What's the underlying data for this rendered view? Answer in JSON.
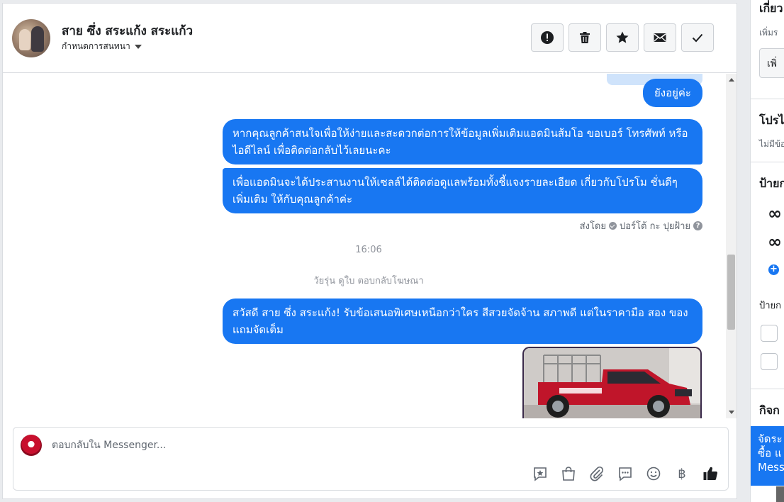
{
  "header": {
    "contact_name": "สาย ซึ่ง สระแก้ง สระแก้ว",
    "assign_label": "กำหนดการสนทนา"
  },
  "toolbar": {
    "icons": [
      "spam-icon",
      "trash-icon",
      "star-icon",
      "mail-icon",
      "checkmark-icon"
    ]
  },
  "messages": [
    {
      "id": "m0",
      "text": "ยังอยู่ค่ะ"
    },
    {
      "id": "m1",
      "text": "หากคุณลูกค้าสนใจเพื่อให้ง่ายและสะดวกต่อการให้ข้อมูลเพิ่มเติมแอดมินส้มโอ ขอเบอร์ โทรศัพท์ หรือ ไอดีไลน์ เพื่อติดต่อกลับไว้เลยนะคะ"
    },
    {
      "id": "m2",
      "text": "เพื่อแอดมินจะได้ประสานงานให้เซลล์ได้ติดต่อดูแลพร้อมทั้งชี้แจงรายละเอียด เกี่ยวกับโปรโม ชั่นดีๆเพิ่มเติม ให้กับคุณลูกค้าค่ะ"
    },
    {
      "id": "m3",
      "text": "สวัสดี สาย ซึ่ง สระแก้ง! รับข้อเสนอพิเศษเหนือกว่าใคร สีสวยจัดจ้าน สภาพดี แต่ในราคามือ สอง ของแถมจัดเต็ม"
    }
  ],
  "sent_by": {
    "prefix": "ส่งโดย",
    "name": "ปอร์โต้ กะ ปุยฝ้าย",
    "help": "?"
  },
  "timestamp": "16:06",
  "ad_reply_note": "วัยรุ่น ดูใบ ตอบกลับโฆษณา",
  "composer": {
    "placeholder": "ตอบกลับใน Messenger...",
    "icons": [
      "saved-reply-icon",
      "shop-bag-icon",
      "attachment-icon",
      "chat-bubble-icon",
      "emoji-icon",
      "baht-icon",
      "thumbs-up-icon"
    ],
    "baht_symbol": "฿"
  },
  "sidebar": {
    "section1_title": "เกี่ยว",
    "section1_sub": "เพิ่มร",
    "section1_button": "เพิ่",
    "section2_title": "โปรไ",
    "section2_sub": "ไม่มีข้อ",
    "section3_title": "ป้ายก",
    "meta_logo": "∞",
    "plus": "+",
    "label_caption": "ป้ายก",
    "section4_title": "กิจก",
    "blue_card": [
      "จัดระ",
      "ซื้อ แ",
      "Mess"
    ]
  },
  "colors": {
    "accent": "#1877f2",
    "bubble_text": "#ffffff",
    "muted_text": "#90949c"
  }
}
